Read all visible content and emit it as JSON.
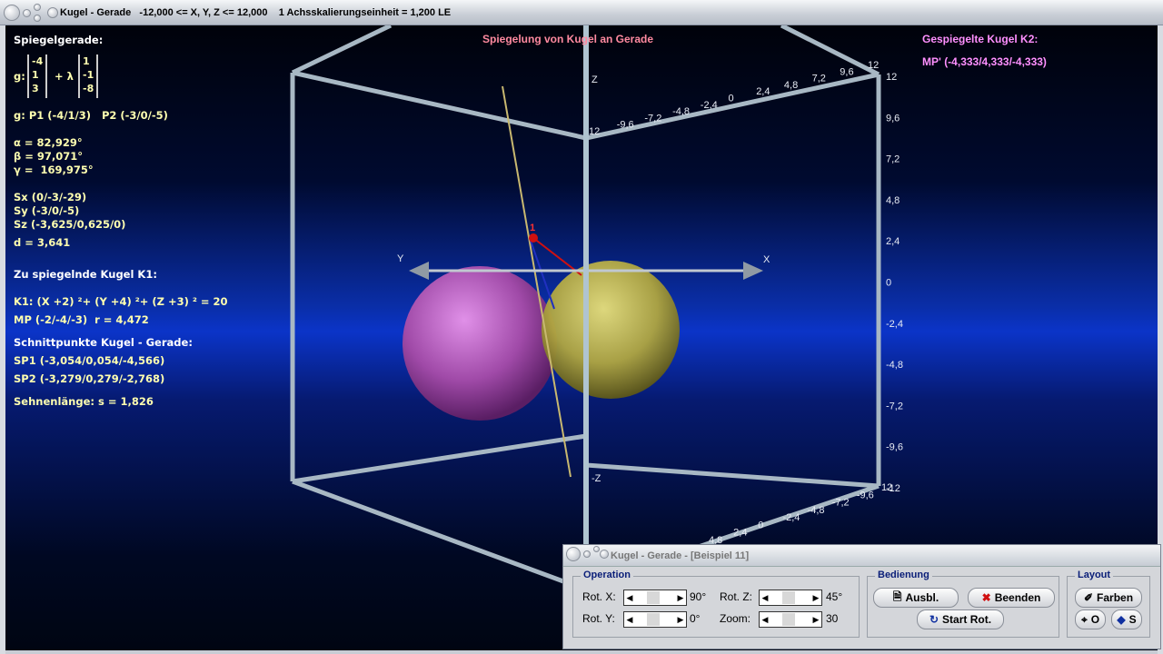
{
  "window": {
    "title": "Kugel - Gerade   -12,000 <= X, Y, Z <= 12,000    1 Achsskalierungseinheit = 1,200 LE"
  },
  "scene_title": "Spiegelung von Kugel an Gerade",
  "left": {
    "heading": "Spiegelgerade:",
    "g_label": "g:",
    "support": [
      "-4",
      "1",
      "3"
    ],
    "plus_lambda": "+ λ",
    "direction": [
      "1",
      "-1",
      "-8"
    ],
    "points": "g: P1 (-4/1/3)   P2 (-3/0/-5)",
    "alpha": "α = 82,929°",
    "beta": "β = 97,071°",
    "gamma": "γ =  169,975°",
    "sx": "Sx (0/-3/-29)",
    "sy": "Sy (-3/0/-5)",
    "sz": "Sz (-3,625/0,625/0)",
    "d": "d = 3,641",
    "k1_heading": "Zu spiegelnde Kugel K1:",
    "k1_eq": "K1: (X +2) ²+ (Y +4) ²+ (Z +3) ² = 20",
    "k1_mp": "MP (-2/-4/-3)  r = 4,472",
    "sp_heading": "Schnittpunkte Kugel - Gerade:",
    "sp1": "SP1 (-3,054/0,054/-4,566)",
    "sp2": "SP2 (-3,279/0,279/-2,768)",
    "chord": "Sehnenlänge: s = 1,826"
  },
  "right": {
    "heading": "Gespiegelte Kugel K2:",
    "mp": "MP' (-4,333/4,333/-4,333)"
  },
  "axes": {
    "x": "X",
    "y": "Y",
    "z": "Z",
    "neg_z": "-Z",
    "point_label": "1",
    "top_ticks": [
      "12",
      "-9,6",
      "-7,2",
      "-4,8",
      "-2,4",
      "0",
      "2,4",
      "4,8",
      "7,2",
      "9,6",
      "12"
    ],
    "vert_ticks": [
      "12",
      "9,6",
      "7,2",
      "4,8",
      "2,4",
      "0",
      "-2,4",
      "-4,8",
      "-7,2",
      "-9,6",
      "-12"
    ],
    "bottom_ticks": [
      "12",
      "-9,6",
      "-7,2",
      "-4,8",
      "-2,4",
      "0",
      "2,4",
      "4,8"
    ]
  },
  "colors": {
    "sphere_k1": "#c060c0",
    "sphere_k2": "#d8d060",
    "line_g": "#c8b870",
    "accent_title": "#ff8aa0",
    "k2_text": "#ff90ff"
  },
  "panel": {
    "title": "Kugel - Gerade - [Beispiel 11]",
    "operation": {
      "label": "Operation",
      "rot_x": "Rot. X:",
      "rot_x_val": "90°",
      "rot_y": "Rot. Y:",
      "rot_y_val": "0°",
      "rot_z": "Rot. Z:",
      "rot_z_val": "45°",
      "zoom": "Zoom:",
      "zoom_val": "30"
    },
    "bedienung": {
      "label": "Bedienung",
      "ausbl": "Ausbl.",
      "beenden": "Beenden",
      "start_rot": "Start Rot."
    },
    "layout": {
      "label": "Layout",
      "farben": "Farben",
      "o": "O",
      "s": "S"
    }
  }
}
